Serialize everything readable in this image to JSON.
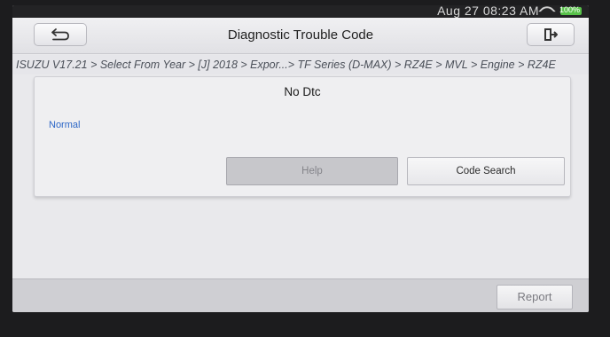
{
  "status_bar": {
    "date_time": "Aug 27   08:23 AM",
    "battery": "100%"
  },
  "header": {
    "title": "Diagnostic Trouble Code",
    "back_icon": "back-arrow-icon",
    "exit_icon": "exit-door-icon"
  },
  "breadcrumb": {
    "path": "ISUZU V17.21 > Select From Year > [J] 2018 > Expor...> TF Series (D-MAX) > RZ4E > MVL > Engine > RZ4E"
  },
  "result": {
    "message": "No Dtc",
    "status": "Normal"
  },
  "buttons": {
    "help": "Help",
    "code_search": "Code Search",
    "report": "Report"
  },
  "colors": {
    "status_text": "#2d67c7",
    "battery": "#58c24a"
  }
}
